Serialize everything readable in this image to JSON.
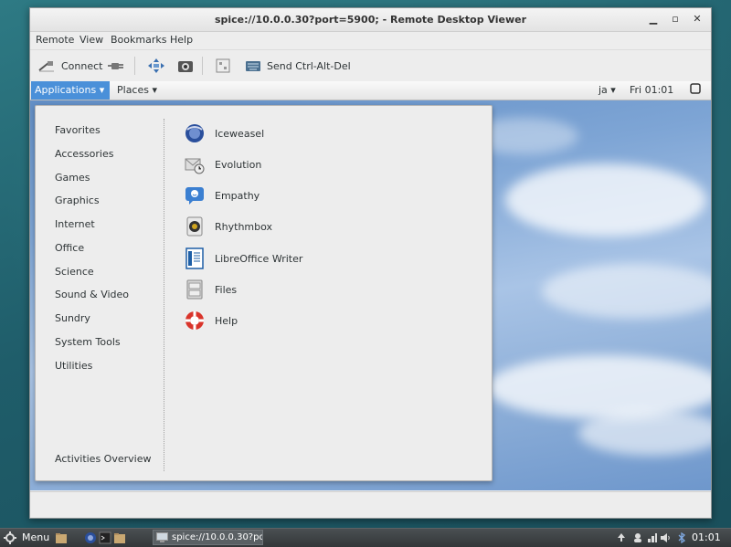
{
  "window": {
    "title": "spice://10.0.0.30?port=5900; - Remote Desktop Viewer",
    "menubar": [
      "Remote",
      "View",
      "Bookmarks",
      "Help"
    ],
    "toolbar": {
      "connect_label": "Connect",
      "send_keys_label": "Send Ctrl-Alt-Del"
    }
  },
  "remote": {
    "topbar": {
      "applications_label": "Applications",
      "places_label": "Places",
      "keyboard_layout": "ja",
      "clock": "Fri 01:01"
    },
    "menu": {
      "categories": [
        "Favorites",
        "Accessories",
        "Games",
        "Graphics",
        "Internet",
        "Office",
        "Science",
        "Sound & Video",
        "Sundry",
        "System Tools",
        "Utilities"
      ],
      "activities_overview": "Activities Overview",
      "apps": [
        {
          "label": "Iceweasel",
          "icon": "iceweasel-icon"
        },
        {
          "label": "Evolution",
          "icon": "evolution-icon"
        },
        {
          "label": "Empathy",
          "icon": "empathy-icon"
        },
        {
          "label": "Rhythmbox",
          "icon": "rhythmbox-icon"
        },
        {
          "label": "LibreOffice Writer",
          "icon": "writer-icon"
        },
        {
          "label": "Files",
          "icon": "files-icon"
        },
        {
          "label": "Help",
          "icon": "help-icon"
        }
      ]
    }
  },
  "panel": {
    "menu_label": "Menu",
    "task_label": "spice://10.0.0.30?po...",
    "clock": "01:01"
  }
}
